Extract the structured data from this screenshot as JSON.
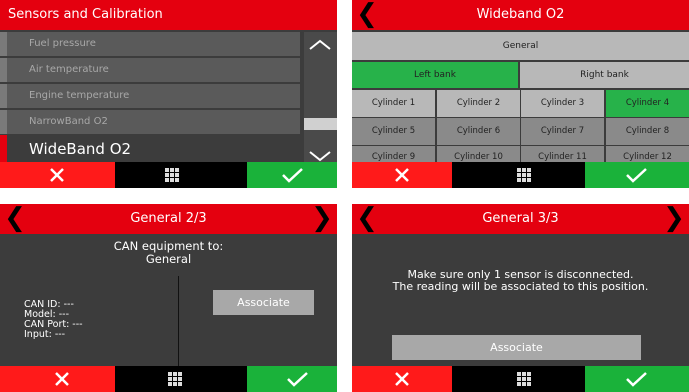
{
  "panel1": {
    "title": "Sensors and Calibration",
    "items": [
      {
        "label": "Fuel pressure"
      },
      {
        "label": "Air temperature"
      },
      {
        "label": "Engine temperature"
      },
      {
        "label": "NarrowBand O2"
      },
      {
        "label": "WideBand O2"
      }
    ]
  },
  "panel2": {
    "title": "Wideband O2",
    "general": "General",
    "left_bank": "Left bank",
    "right_bank": "Right bank",
    "cylinders": [
      "Cylinder 1",
      "Cylinder 2",
      "Cylinder 3",
      "Cylinder 4",
      "Cylinder 5",
      "Cylinder 6",
      "Cylinder 7",
      "Cylinder 8",
      "Cylinder 9",
      "Cylinder 10",
      "Cylinder 11",
      "Cylinder 12"
    ]
  },
  "panel3": {
    "title": "General 2/3",
    "can_line1": "CAN equipment to:",
    "can_line2": "General",
    "can_id": "CAN ID: ---",
    "model": "Model: ---",
    "can_port": "CAN Port: ---",
    "input": "Input: ---",
    "associate": "Associate"
  },
  "panel4": {
    "title": "General 3/3",
    "msg_line1": "Make sure only 1 sensor is disconnected.",
    "msg_line2": "The reading will be associated to this position.",
    "associate": "Associate"
  },
  "colors": {
    "title_red": "#e4000f",
    "cancel_red": "#ff1a1a",
    "ok_green": "#1ab23a",
    "active_green": "#27b24a"
  },
  "icons": {
    "cancel": "close-icon",
    "menu": "grid-icon",
    "ok": "check-icon",
    "back": "chevron-left-icon",
    "next": "chevron-right-icon"
  }
}
